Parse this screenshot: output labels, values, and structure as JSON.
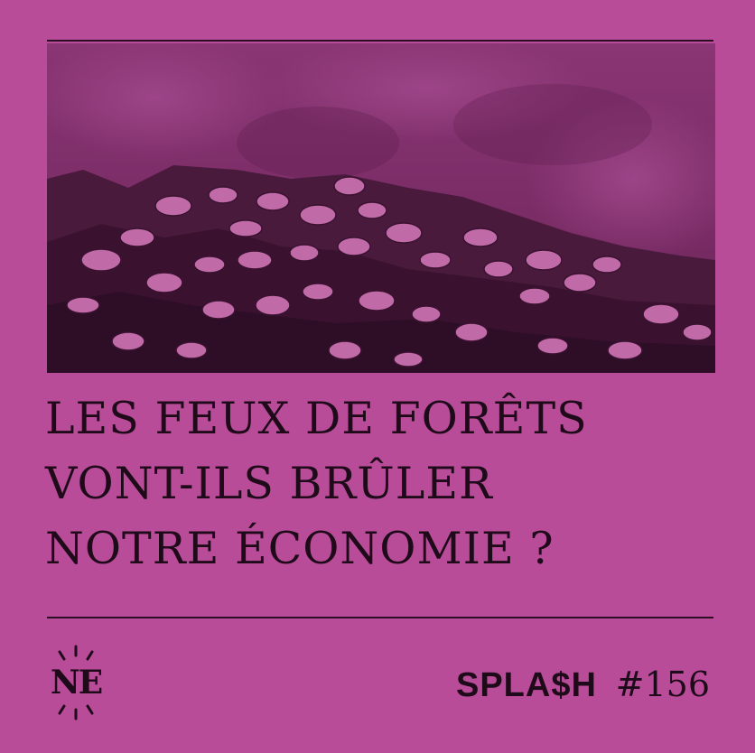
{
  "colors": {
    "background": "#b84c98",
    "ink": "#1f0a1a",
    "photo_dark": "#4a1a3d",
    "photo_mid": "#7a2a63",
    "coin": "#c06aa8"
  },
  "image": {
    "subject": "coins-on-rocks-photo"
  },
  "headline": {
    "line1": "LES FEUX DE FORÊTS",
    "line2": "VONT-ILS BRÛLER",
    "line3": "NOTRE ÉCONOMIE ?"
  },
  "logo": {
    "text": "NE"
  },
  "issue": {
    "brand": "SPLA$H",
    "number": "#156"
  }
}
